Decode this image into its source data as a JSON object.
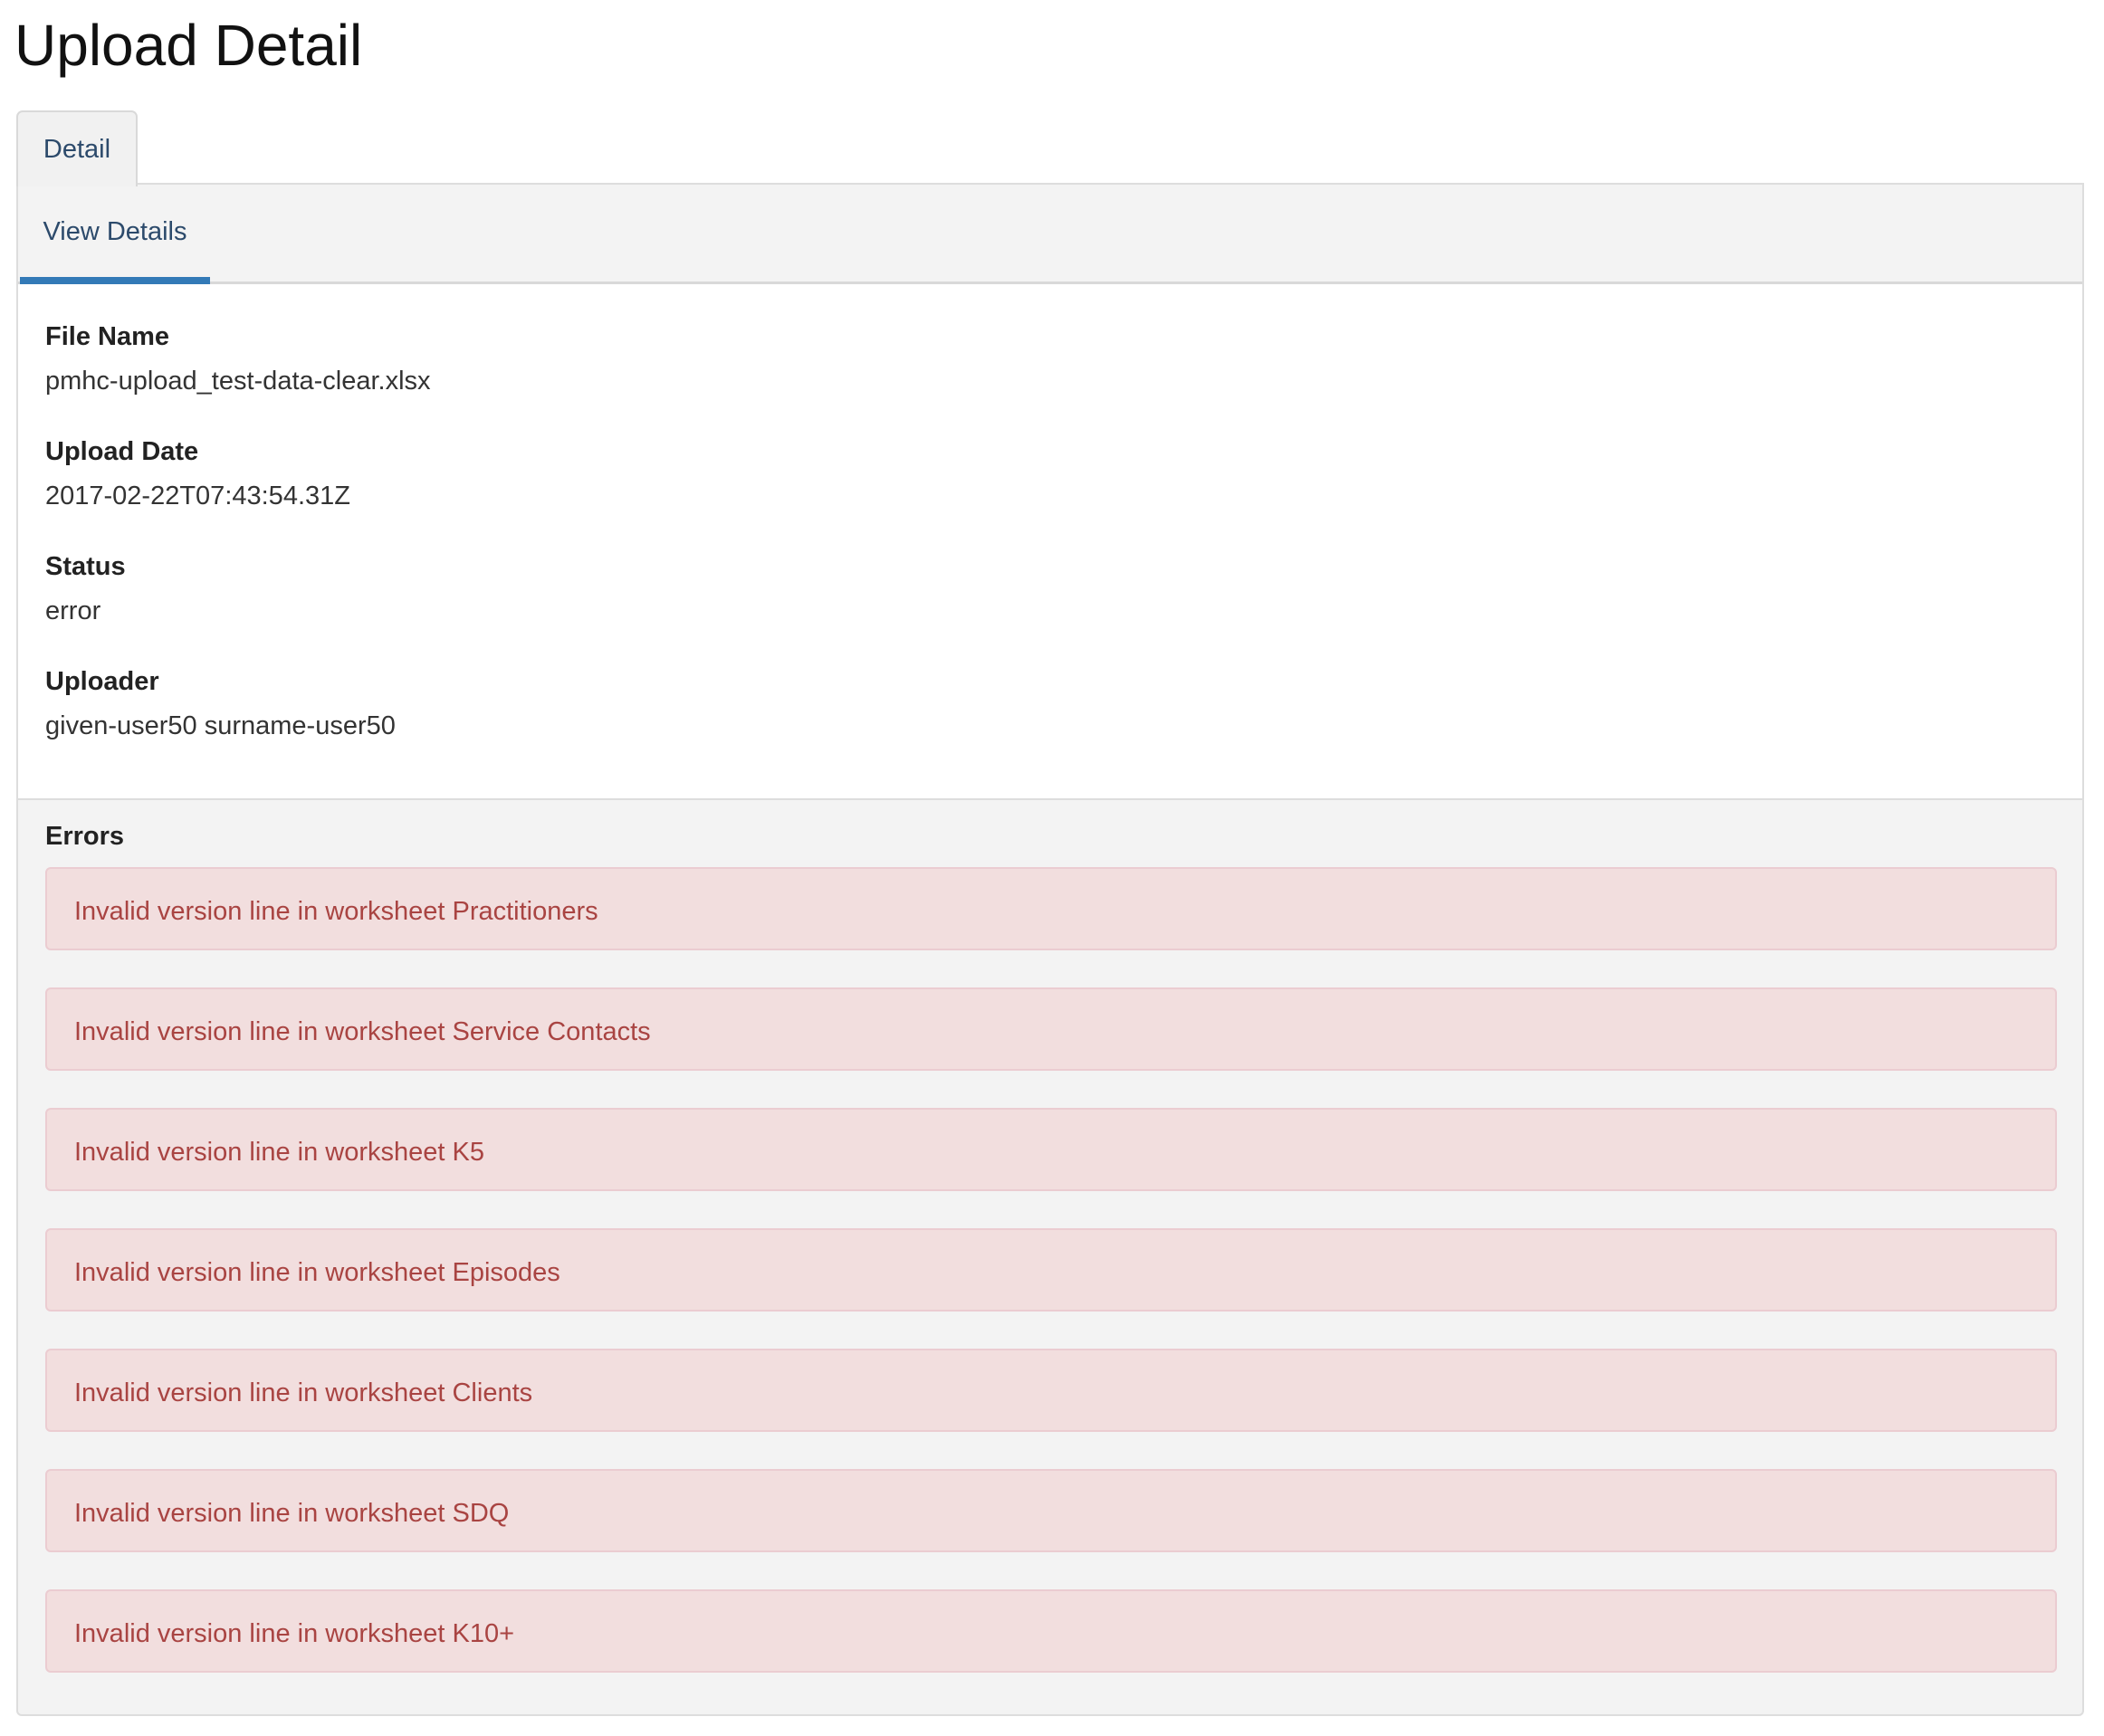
{
  "page": {
    "title": "Upload Detail"
  },
  "tabs": {
    "outer": "Detail",
    "inner": "View Details"
  },
  "details": {
    "file_name": {
      "label": "File Name",
      "value": "pmhc-upload_test-data-clear.xlsx"
    },
    "upload_date": {
      "label": "Upload Date",
      "value": "2017-02-22T07:43:54.31Z"
    },
    "status": {
      "label": "Status",
      "value": "error"
    },
    "uploader": {
      "label": "Uploader",
      "value": "given-user50 surname-user50"
    }
  },
  "errors": {
    "title": "Errors",
    "items": [
      "Invalid version line in worksheet Practitioners",
      "Invalid version line in worksheet Service Contacts",
      "Invalid version line in worksheet K5",
      "Invalid version line in worksheet Episodes",
      "Invalid version line in worksheet Clients",
      "Invalid version line in worksheet SDQ",
      "Invalid version line in worksheet K10+"
    ]
  },
  "colors": {
    "accent": "#337ab7",
    "error_text": "#a94442",
    "error_background": "#f2dede",
    "error_border": "#ebccd1"
  }
}
